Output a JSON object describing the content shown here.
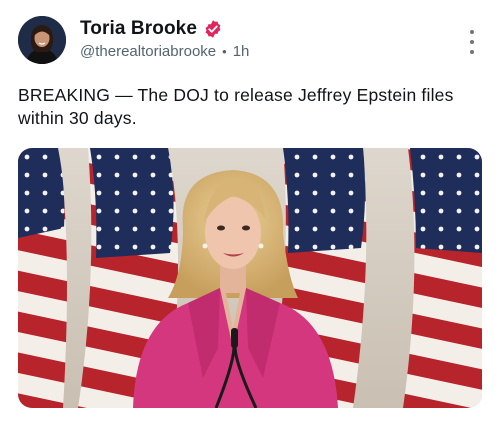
{
  "author": {
    "display_name": "Toria Brooke",
    "handle": "@therealtoriabrooke",
    "separator": "•",
    "time": "1h",
    "verified": true
  },
  "post": {
    "text": "BREAKING — The DOJ to release Jeffrey Epstein files within 30 days."
  },
  "icons": {
    "verified": "verified-badge-icon",
    "more": "more-vertical-icon"
  },
  "colors": {
    "verified_badge": "#e0245e",
    "text_primary": "#0f1419",
    "text_secondary": "#536471"
  }
}
